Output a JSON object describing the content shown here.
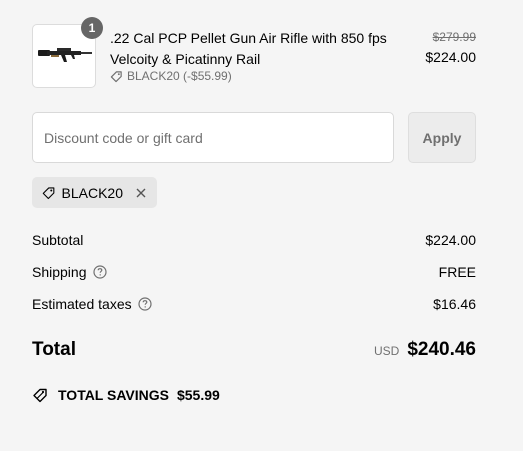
{
  "product": {
    "quantity": "1",
    "title": ".22 Cal PCP Pellet Gun Air Rifle with 850 fps Velcoity & Picatinny Rail",
    "discount_line": "BLACK20 (-$55.99)",
    "original_price": "$279.99",
    "price": "$224.00",
    "image_icon": "rifle-image"
  },
  "discount": {
    "placeholder": "Discount code or gift card",
    "value": "",
    "apply_label": "Apply",
    "applied_code": "BLACK20"
  },
  "summary": {
    "subtotal_label": "Subtotal",
    "subtotal_value": "$224.00",
    "shipping_label": "Shipping",
    "shipping_value": "FREE",
    "taxes_label": "Estimated taxes",
    "taxes_value": "$16.46",
    "total_label": "Total",
    "currency": "USD",
    "total_value": "$240.46"
  },
  "savings": {
    "label": "TOTAL SAVINGS",
    "amount": "$55.99"
  },
  "colors": {
    "background": "#f5f5f5",
    "muted_text": "#707070",
    "badge": "#666666",
    "tag_bg": "#e6e6e6"
  }
}
